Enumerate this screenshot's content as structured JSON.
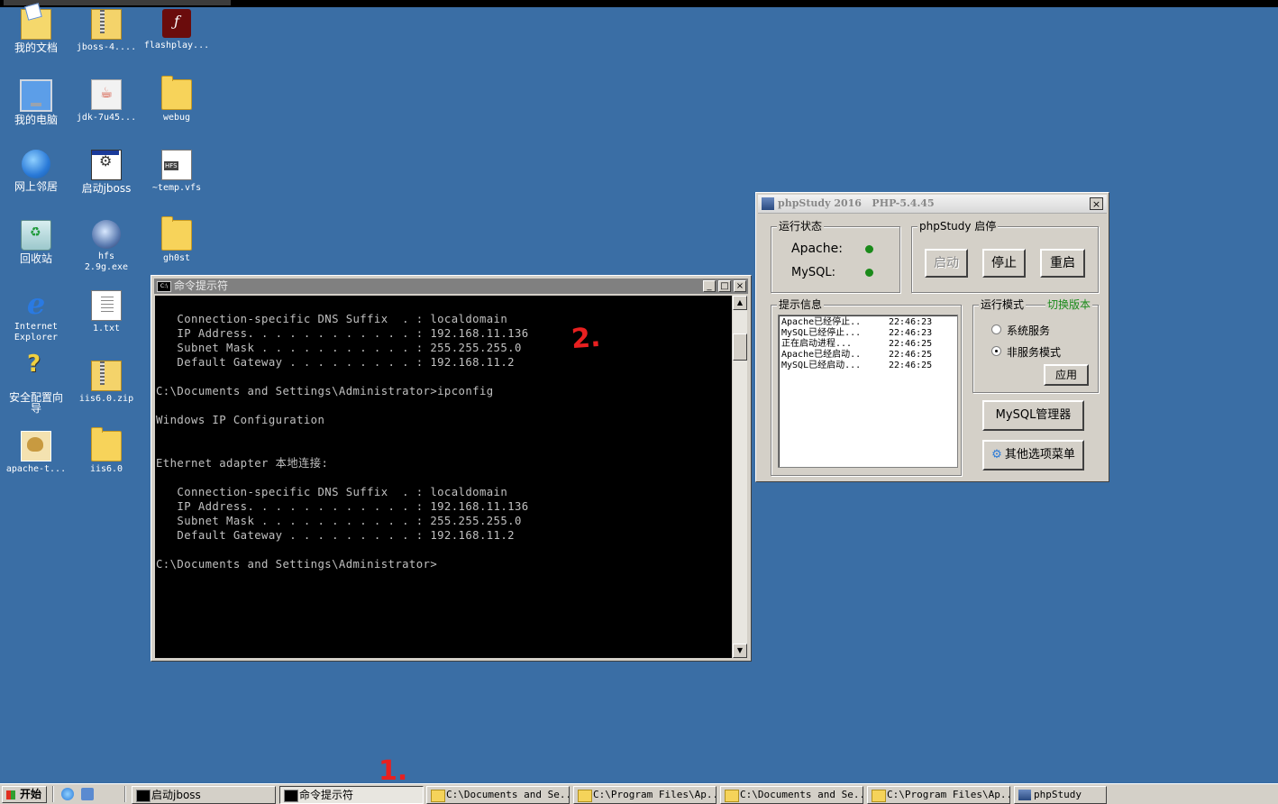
{
  "desktop": {
    "icons": [
      {
        "label": "我的文档",
        "icon": "my-documents-icon"
      },
      {
        "label": "jboss-4....",
        "icon": "zip-icon"
      },
      {
        "label": "flashplay...",
        "icon": "flash-icon"
      },
      {
        "label": "我的电脑",
        "icon": "my-computer-icon"
      },
      {
        "label": "jdk-7u45...",
        "icon": "java-icon"
      },
      {
        "label": "webug",
        "icon": "folder-icon"
      },
      {
        "label": "网上邻居",
        "icon": "network-icon"
      },
      {
        "label": "启动jboss",
        "icon": "batch-icon"
      },
      {
        "label": "~temp.vfs",
        "icon": "vfs-icon"
      },
      {
        "label": "回收站",
        "icon": "recycle-bin-icon"
      },
      {
        "label": "hfs",
        "label2": "2.9g.exe",
        "icon": "hfs-icon"
      },
      {
        "label": "gh0st",
        "icon": "folder-icon"
      },
      {
        "label": "Internet",
        "label2": "Explorer",
        "icon": "ie-icon"
      },
      {
        "label": "1.txt",
        "icon": "text-file-icon"
      },
      {
        "label": "安全配置向",
        "label2": "导",
        "icon": "security-wizard-icon"
      },
      {
        "label": "iis6.0.zip",
        "icon": "zip-icon"
      },
      {
        "label": "apache-t...",
        "icon": "tomcat-icon"
      },
      {
        "label": "iis6.0",
        "icon": "folder-icon"
      }
    ]
  },
  "cmd": {
    "title": "命令提示符",
    "min_label": "_",
    "max_label": "□",
    "close_label": "×",
    "lines": [
      "   Connection-specific DNS Suffix  . : localdomain",
      "   IP Address. . . . . . . . . . . . : 192.168.11.136",
      "   Subnet Mask . . . . . . . . . . . : 255.255.255.0",
      "   Default Gateway . . . . . . . . . : 192.168.11.2",
      "",
      "C:\\Documents and Settings\\Administrator>ipconfig",
      "",
      "Windows IP Configuration",
      "",
      "",
      "Ethernet adapter 本地连接:",
      "",
      "   Connection-specific DNS Suffix  . : localdomain",
      "   IP Address. . . . . . . . . . . . : 192.168.11.136",
      "   Subnet Mask . . . . . . . . . . . : 255.255.255.0",
      "   Default Gateway . . . . . . . . . : 192.168.11.2",
      "",
      "C:\\Documents and Settings\\Administrator>"
    ]
  },
  "phpstudy": {
    "title": "phpStudy 2016   PHP-5.4.45",
    "close_label": "×",
    "status_group": "运行状态",
    "apache_label": "Apache:",
    "mysql_label": "MySQL:",
    "status_color": "#1a8a1a",
    "control_group": "phpStudy 启停",
    "start_label": "启动",
    "stop_label": "停止",
    "restart_label": "重启",
    "info_group": "提示信息",
    "log": [
      {
        "msg": "Apache已经停止..",
        "time": "22:46:23"
      },
      {
        "msg": "MySQL已经停止...",
        "time": "22:46:23"
      },
      {
        "msg": "正在启动进程...",
        "time": "22:46:25"
      },
      {
        "msg": "Apache已经启动..",
        "time": "22:46:25"
      },
      {
        "msg": "MySQL已经启动...",
        "time": "22:46:25"
      }
    ],
    "mode_group": "运行模式",
    "switch_version": "切换版本",
    "mode_service": "系统服务",
    "mode_nonservice": "非服务模式",
    "apply_label": "应用",
    "mysql_manager": "MySQL管理器",
    "other_menu": "其他选项菜单"
  },
  "annotations": {
    "first": "1.",
    "second": "2."
  },
  "taskbar": {
    "start_label": "开始",
    "buttons": [
      {
        "label": "启动jboss",
        "icon": "cmd-icon"
      },
      {
        "label": "命令提示符",
        "icon": "cmd-icon",
        "active": true
      },
      {
        "label": "C:\\Documents and Se...",
        "icon": "folder-icon"
      },
      {
        "label": "C:\\Program Files\\Ap...",
        "icon": "folder-icon"
      },
      {
        "label": "C:\\Documents and Se...",
        "icon": "folder-icon"
      },
      {
        "label": "C:\\Program Files\\Ap...",
        "icon": "folder-icon"
      },
      {
        "label": "phpStudy",
        "icon": "phpstudy-icon"
      }
    ]
  }
}
